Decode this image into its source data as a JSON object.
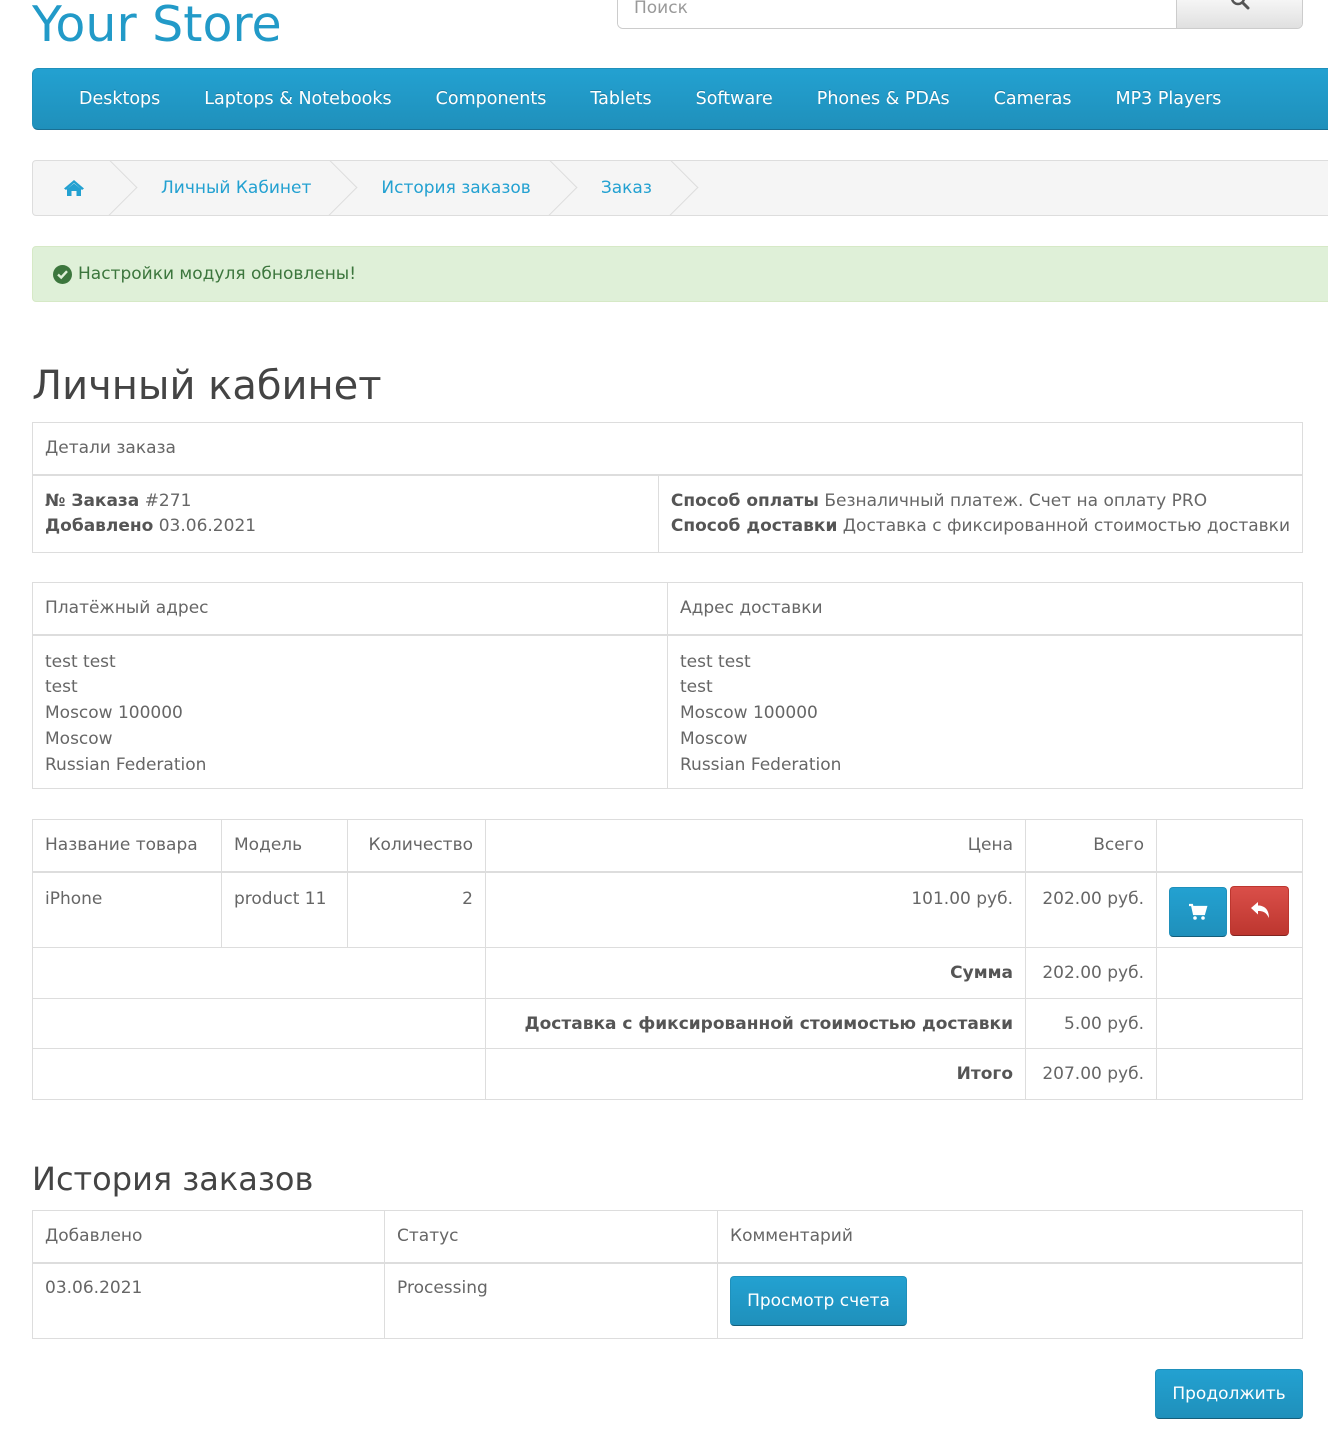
{
  "header": {
    "logo": "Your Store",
    "search_placeholder": "Поиск"
  },
  "nav": {
    "items": [
      "Desktops",
      "Laptops & Notebooks",
      "Components",
      "Tablets",
      "Software",
      "Phones & PDAs",
      "Cameras",
      "MP3 Players"
    ]
  },
  "breadcrumb": {
    "items": [
      "Личный Кабинет",
      "История заказов",
      "Заказ"
    ]
  },
  "alert": {
    "text": "Настройки модуля обновлены!",
    "color": "#3c763d"
  },
  "page": {
    "title": "Личный кабинет"
  },
  "order_details": {
    "heading": "Детали заказа",
    "order_no_label": "№ Заказа",
    "order_no": "#271",
    "added_label": "Добавлено",
    "added": "03.06.2021",
    "payment_label": "Способ оплаты",
    "payment": "Безналичный платеж. Счет на оплату PRO",
    "shipping_label": "Способ доставки",
    "shipping": "Доставка с фиксированной стоимостью доставки"
  },
  "addresses": {
    "payment_heading": "Платёжный адрес",
    "shipping_heading": "Адрес доставки",
    "payment_lines": [
      "test test",
      "test",
      "Moscow 100000",
      "Moscow",
      "Russian Federation"
    ],
    "shipping_lines": [
      "test test",
      "test",
      "Moscow 100000",
      "Moscow",
      "Russian Federation"
    ]
  },
  "products": {
    "headers": [
      "Название товара",
      "Модель",
      "Количество",
      "Цена",
      "Всего"
    ],
    "rows": [
      {
        "name": "iPhone",
        "model": "product 11",
        "qty": "2",
        "price": "101.00 руб.",
        "total": "202.00 руб."
      }
    ],
    "totals": [
      {
        "label": "Сумма",
        "value": "202.00 руб."
      },
      {
        "label": "Доставка с фиксированной стоимостью доставки",
        "value": "5.00 руб."
      },
      {
        "label": "Итого",
        "value": "207.00 руб."
      }
    ]
  },
  "history": {
    "title": "История заказов",
    "headers": [
      "Добавлено",
      "Статус",
      "Комментарий"
    ],
    "rows": [
      {
        "date": "03.06.2021",
        "status": "Processing",
        "button": "Просмотр счета"
      }
    ]
  },
  "footer": {
    "continue": "Продолжить"
  },
  "icons": {
    "search": "search-icon",
    "home": "home-icon",
    "check": "check-circle-icon",
    "cart": "cart-icon",
    "reply": "reply-icon"
  },
  "colors": {
    "accent": "#229ac8",
    "nav": "#1f90bb",
    "danger": "#bd362f",
    "success_bg": "#dff0d8"
  }
}
